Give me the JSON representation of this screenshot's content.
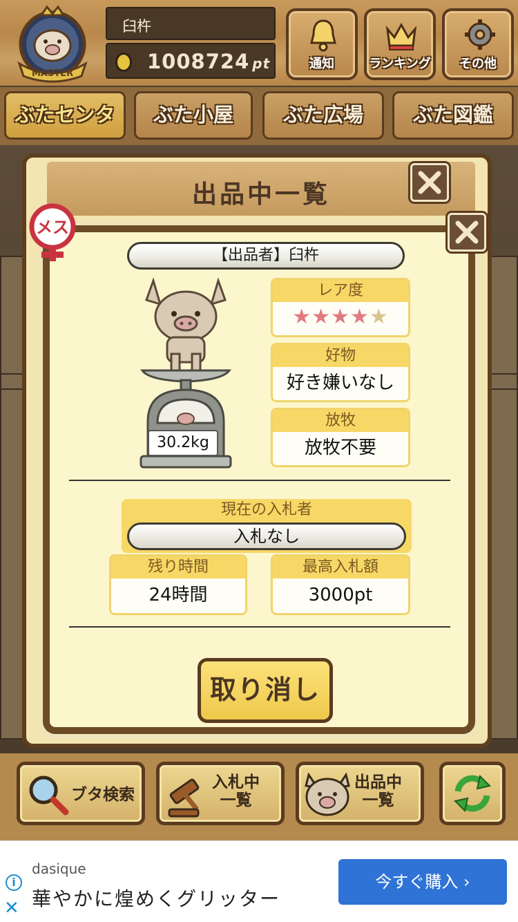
{
  "header": {
    "username": "臼杵",
    "points": "1008724",
    "points_unit": "pt",
    "badge_label": "MASTER",
    "buttons": [
      {
        "label": "通知",
        "icon": "bell-icon"
      },
      {
        "label": "ランキング",
        "icon": "crown-icon"
      },
      {
        "label": "その他",
        "icon": "gear-icon"
      }
    ]
  },
  "tabs": [
    {
      "label": "ぶたセンター",
      "active": true
    },
    {
      "label": "ぶた小屋",
      "active": false
    },
    {
      "label": "ぶた広場",
      "active": false
    },
    {
      "label": "ぶた図鑑",
      "active": false
    }
  ],
  "listing_panel": {
    "title": "出品中一覧"
  },
  "detail": {
    "gender_label": "メス",
    "seller": "【出品者】臼杵",
    "weight": "30.2kg",
    "rarity": {
      "label": "レア度",
      "stars_filled": 4,
      "stars_total": 5
    },
    "favorite": {
      "label": "好物",
      "value": "好き嫌いなし"
    },
    "grazing": {
      "label": "放牧",
      "value": "放牧不要"
    },
    "current_bidder": {
      "label": "現在の入札者",
      "value": "入札なし"
    },
    "remaining_time": {
      "label": "残り時間",
      "value": "24時間"
    },
    "highest_bid": {
      "label": "最高入札額",
      "value": "3000pt"
    },
    "cancel_label": "取り消し"
  },
  "bottom_nav": [
    {
      "label": "ブタ検索",
      "icon": "magnifier-icon"
    },
    {
      "label": "入札中\n一覧",
      "icon": "gavel-icon"
    },
    {
      "label": "出品中\n一覧",
      "icon": "pig-icon"
    },
    {
      "label": "",
      "icon": "refresh-icon"
    }
  ],
  "ad": {
    "brand": "dasique",
    "tagline": "華やかに煌めくグリッター",
    "cta": "今すぐ購入 ›"
  },
  "colors": {
    "panel_yellow": "#fcf6cc",
    "card_header": "#f7d866",
    "star_filled": "#e07c80",
    "star_empty": "#d6c48a",
    "ad_button": "#2f73d6"
  }
}
